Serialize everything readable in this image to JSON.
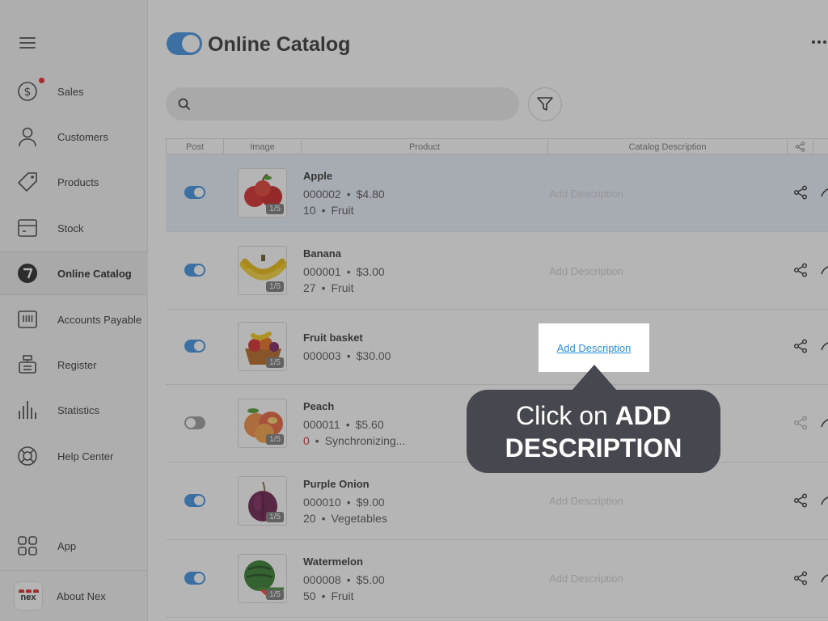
{
  "sidebar": {
    "items": [
      {
        "label": "Sales",
        "icon": "dollar-circle-icon"
      },
      {
        "label": "Customers",
        "icon": "person-icon"
      },
      {
        "label": "Products",
        "icon": "tag-icon"
      },
      {
        "label": "Stock",
        "icon": "box-icon"
      },
      {
        "label": "Online Catalog",
        "icon": "catalog-icon",
        "active": true
      },
      {
        "label": "Accounts Payable",
        "icon": "barcode-icon"
      },
      {
        "label": "Register",
        "icon": "register-icon"
      },
      {
        "label": "Statistics",
        "icon": "bar-chart-icon"
      },
      {
        "label": "Help Center",
        "icon": "lifebuoy-icon"
      }
    ],
    "app": {
      "label": "App",
      "icon": "grid-icon"
    },
    "about": {
      "label": "About Nex",
      "logo_text": "nex"
    }
  },
  "header": {
    "title": "Online Catalog",
    "catalog_enabled": true
  },
  "search": {
    "value": "",
    "placeholder": ""
  },
  "table": {
    "columns": [
      "Post",
      "Image",
      "Product",
      "Catalog Description"
    ],
    "rows": [
      {
        "name": "Apple",
        "code": "000002",
        "price": "$4.80",
        "qty": "10",
        "category": "Fruit",
        "images": "1/5",
        "posted": true,
        "description": "Add Description",
        "selected": true
      },
      {
        "name": "Banana",
        "code": "000001",
        "price": "$3.00",
        "qty": "27",
        "category": "Fruit",
        "images": "1/5",
        "posted": true,
        "description": "Add Description"
      },
      {
        "name": "Fruit basket",
        "code": "000003",
        "price": "$30.00",
        "images": "1/5",
        "posted": true,
        "description": "Add Description"
      },
      {
        "name": "Peach",
        "code": "000011",
        "price": "$5.60",
        "qty": "0",
        "category": "Synchronizing...",
        "images": "1/5",
        "posted": false,
        "description": "Add Description"
      },
      {
        "name": "Purple Onion",
        "code": "000010",
        "price": "$9.00",
        "qty": "20",
        "category": "Vegetables",
        "images": "1/5",
        "posted": true,
        "description": "Add Description"
      },
      {
        "name": "Watermelon",
        "code": "000008",
        "price": "$5.00",
        "qty": "50",
        "category": "Fruit",
        "images": "1/5",
        "posted": true,
        "description": "Add Description"
      }
    ]
  },
  "tutorial": {
    "highlight_label": "Add Description",
    "callout_prefix": "Click on",
    "callout_bold_1": "ADD",
    "callout_bold_2": "DESCRIPTION"
  },
  "colors": {
    "accent": "#3d8ee0",
    "link": "#2d8fe0",
    "alert_red": "#e02424",
    "callout_bg": "#474750"
  }
}
